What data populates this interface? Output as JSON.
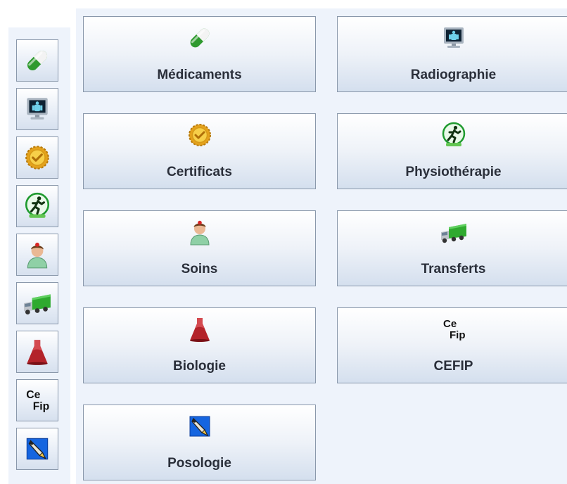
{
  "sidebar": {
    "items": [
      {
        "icon": "capsule-icon"
      },
      {
        "icon": "xray-monitor-icon"
      },
      {
        "icon": "certificate-seal-icon"
      },
      {
        "icon": "running-man-icon"
      },
      {
        "icon": "nurse-icon"
      },
      {
        "icon": "truck-icon"
      },
      {
        "icon": "flask-icon"
      },
      {
        "icon": "cefip-icon",
        "text_top": "Ce",
        "text_bottom": "Fip"
      },
      {
        "icon": "pen-icon"
      }
    ]
  },
  "tiles": [
    {
      "label": "Médicaments",
      "icon": "capsule-icon"
    },
    {
      "label": "Radiographie",
      "icon": "xray-monitor-icon"
    },
    {
      "label": "Certificats",
      "icon": "certificate-seal-icon"
    },
    {
      "label": "Physiothérapie",
      "icon": "running-man-icon"
    },
    {
      "label": "Soins",
      "icon": "nurse-icon"
    },
    {
      "label": "Transferts",
      "icon": "truck-icon"
    },
    {
      "label": "Biologie",
      "icon": "flask-icon"
    },
    {
      "label": "CEFIP",
      "icon": "cefip-icon",
      "text_top": "Ce",
      "text_bottom": "Fip"
    },
    {
      "label": "Posologie",
      "icon": "pen-icon"
    }
  ],
  "colors": {
    "panel_bg": "#eef3fb",
    "border": "#8a98ab",
    "label": "#2a2f3a"
  }
}
